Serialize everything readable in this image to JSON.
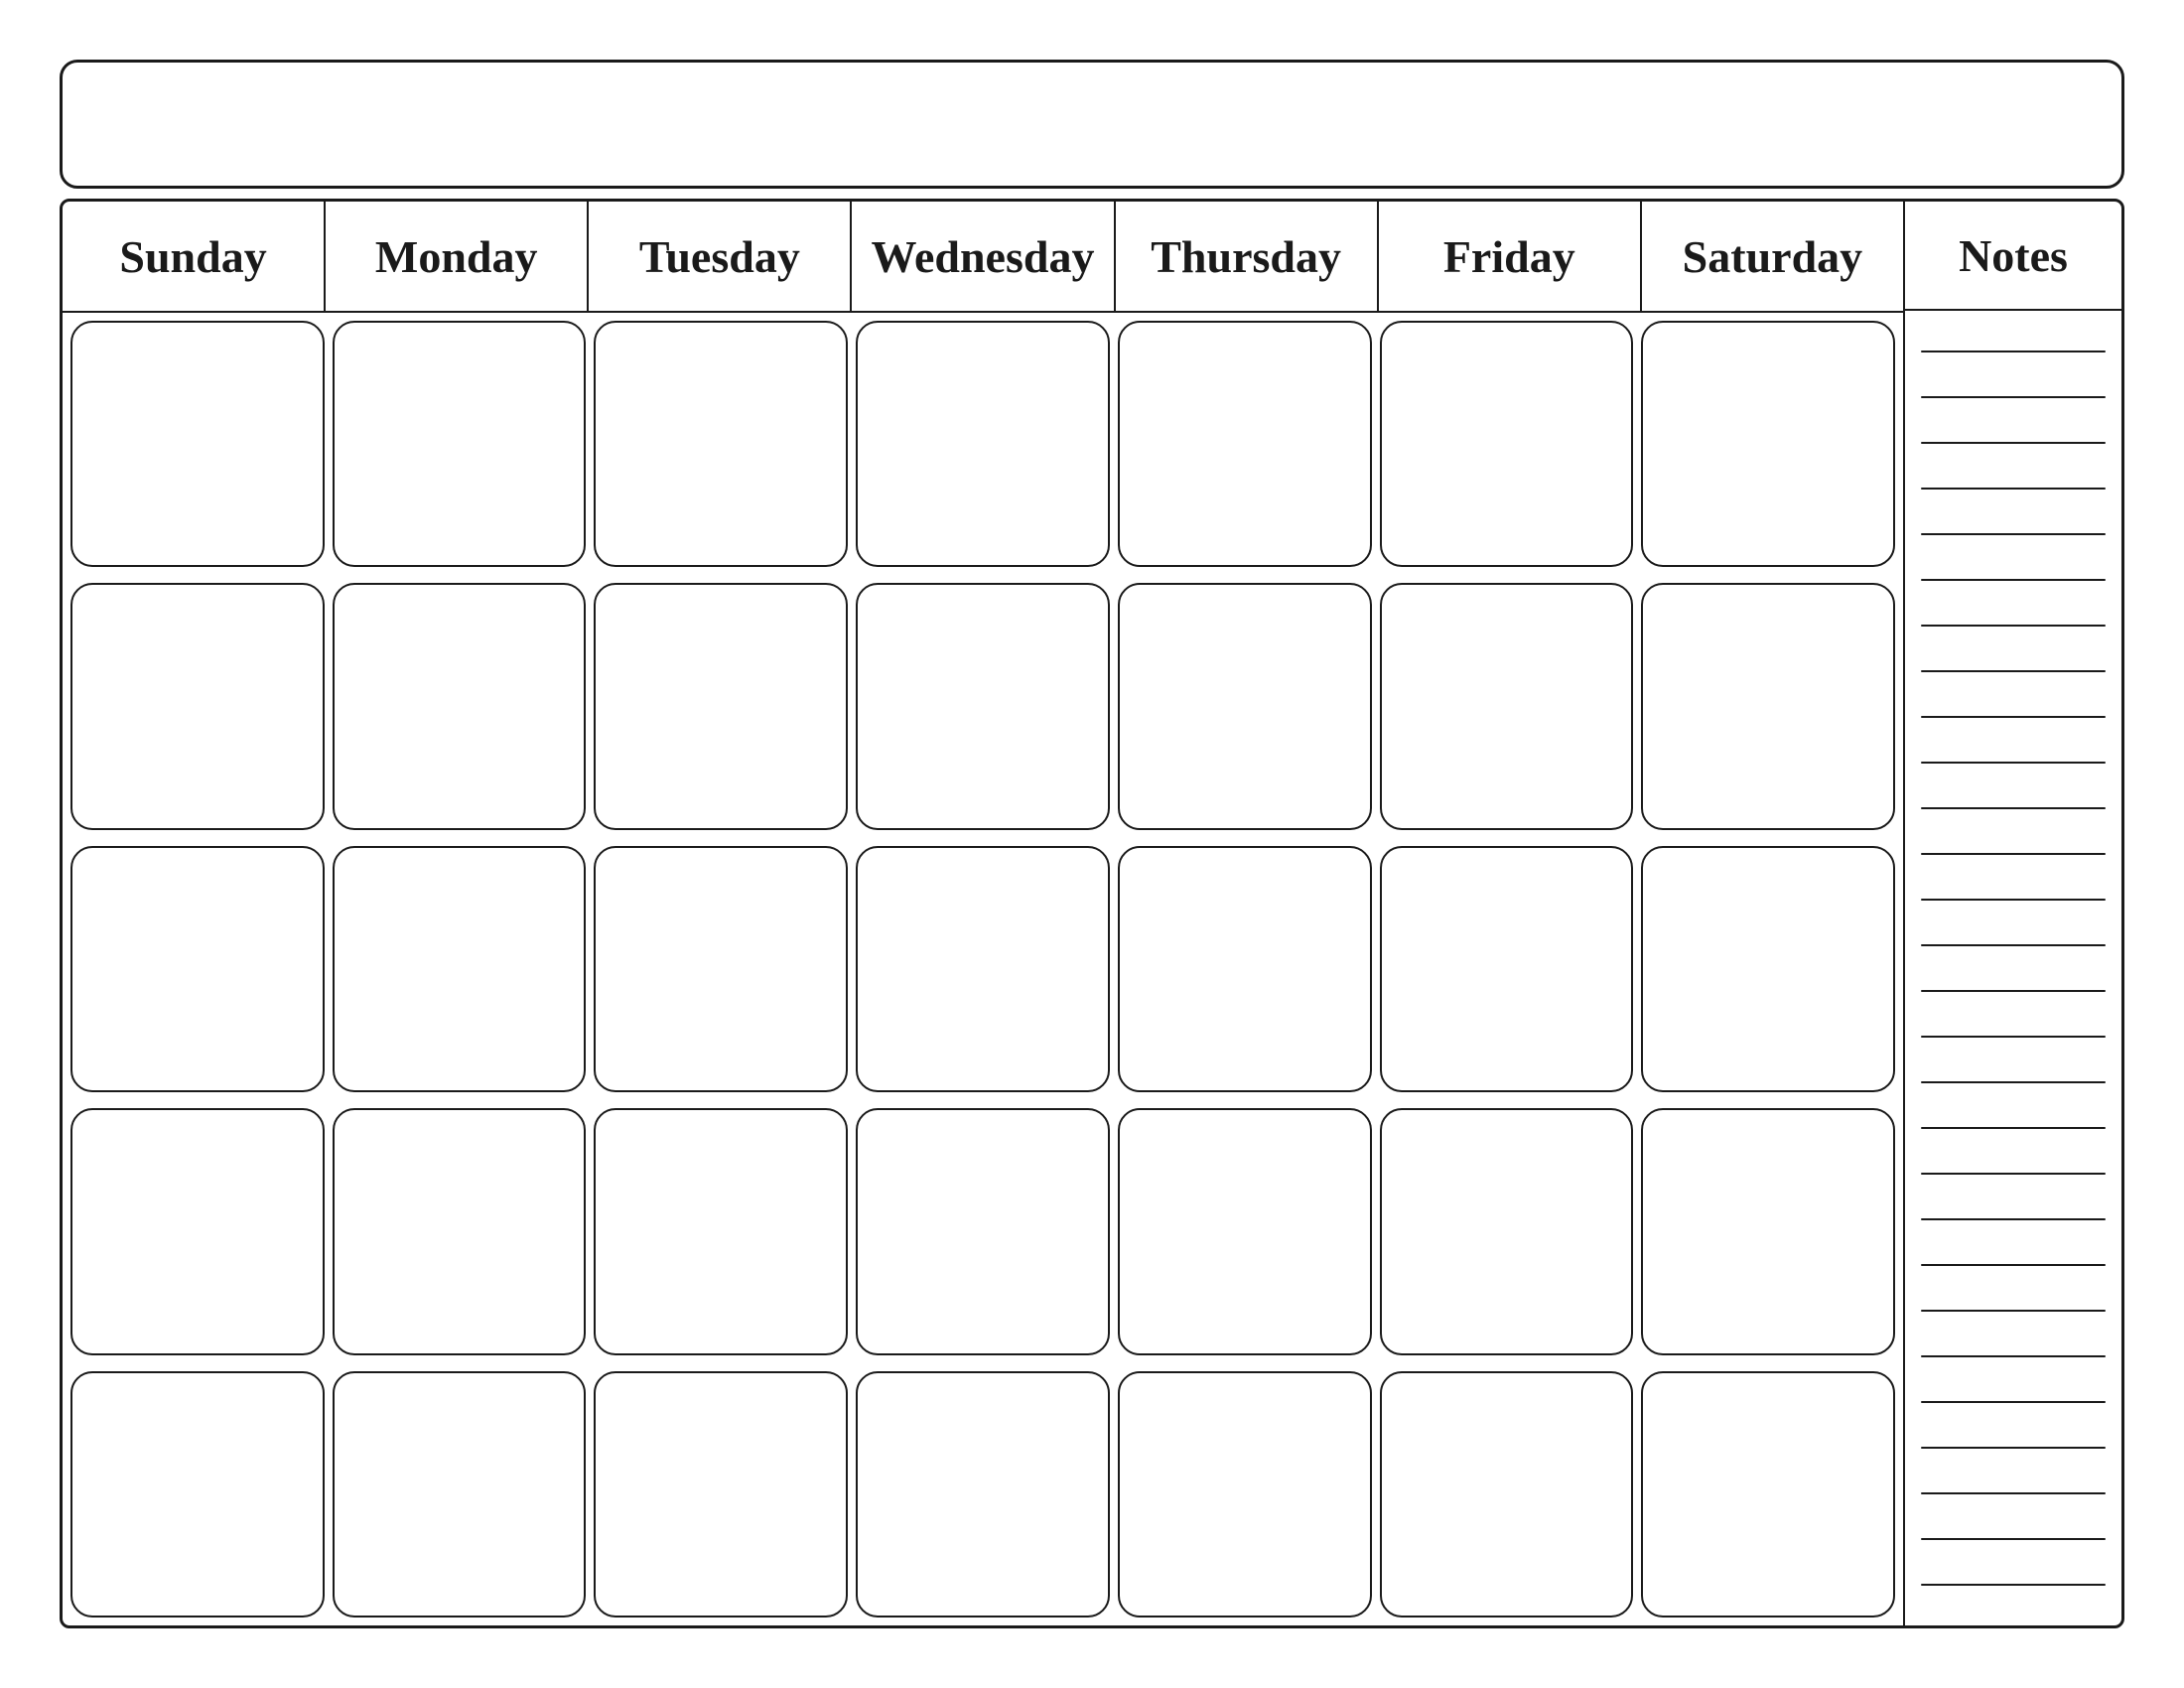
{
  "calendar": {
    "title": "",
    "days": [
      "Sunday",
      "Monday",
      "Tuesday",
      "Wednesday",
      "Thursday",
      "Friday",
      "Saturday"
    ],
    "notes_label": "Notes",
    "weeks": 5,
    "note_lines": 28
  }
}
